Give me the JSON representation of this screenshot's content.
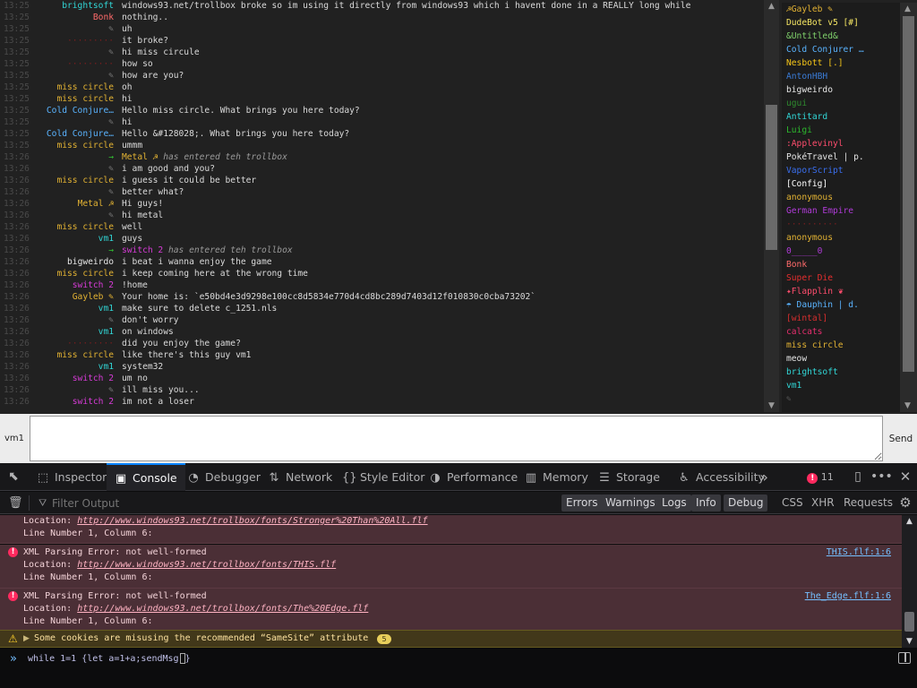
{
  "colors": {
    "timestamp": "#4a4a4a",
    "message_text": "#dadada",
    "devtools_bg": "#0c0c0d",
    "error_bg": "#4b2f36",
    "warning_bg": "#42381a",
    "accent": "#0a84ff"
  },
  "chat": {
    "messages": [
      {
        "time": "13:25",
        "nick": "brightsoft",
        "nick_color": "#31d6d6",
        "text": "windows93.net/trollbox broke so im using it directly from windows93 which i havent done in a REALLY long while",
        "type": "msg"
      },
      {
        "time": "13:25",
        "nick": "Bonk",
        "nick_color": "#ff6b6b",
        "text": "nothing..",
        "type": "msg"
      },
      {
        "time": "13:25",
        "nick": "✎",
        "nick_color": "#777777",
        "text": "uh",
        "type": "msg"
      },
      {
        "time": "13:25",
        "nick": "·········",
        "nick_color": "#7a1f1f",
        "text": "it broke?",
        "type": "msg"
      },
      {
        "time": "13:25",
        "nick": "✎",
        "nick_color": "#777777",
        "text": "hi miss circule",
        "type": "msg"
      },
      {
        "time": "13:25",
        "nick": "·········",
        "nick_color": "#7a1f1f",
        "text": "how so",
        "type": "msg"
      },
      {
        "time": "13:25",
        "nick": "✎",
        "nick_color": "#777777",
        "text": "how are you?",
        "type": "msg"
      },
      {
        "time": "13:25",
        "nick": "miss circle",
        "nick_color": "#e2b233",
        "text": "oh",
        "type": "msg"
      },
      {
        "time": "13:25",
        "nick": "miss circle",
        "nick_color": "#e2b233",
        "text": "hi",
        "type": "msg"
      },
      {
        "time": "13:25",
        "nick": "Cold Conjure…",
        "nick_color": "#5ab4ff",
        "text": "Hello miss circle. What brings you here today?",
        "type": "msg"
      },
      {
        "time": "13:25",
        "nick": "✎",
        "nick_color": "#777777",
        "text": "hi",
        "type": "msg"
      },
      {
        "time": "13:25",
        "nick": "Cold Conjure…",
        "nick_color": "#5ab4ff",
        "text": "Hello &#128028;. What brings you here today?",
        "type": "msg"
      },
      {
        "time": "13:25",
        "nick": "miss circle",
        "nick_color": "#e2b233",
        "text": "ummm",
        "type": "msg"
      },
      {
        "time": "13:26",
        "nick": "→",
        "nick_color": "#33c733",
        "sys_name": "Metal ☭",
        "sys_color": "#e2b233",
        "text": "has entered teh trollbox",
        "type": "sys"
      },
      {
        "time": "13:26",
        "nick": "✎",
        "nick_color": "#777777",
        "text": "i am good and you?",
        "type": "msg"
      },
      {
        "time": "13:26",
        "nick": "miss circle",
        "nick_color": "#e2b233",
        "text": "i guess it could be better",
        "type": "msg"
      },
      {
        "time": "13:26",
        "nick": "✎",
        "nick_color": "#777777",
        "text": "better what?",
        "type": "msg"
      },
      {
        "time": "13:26",
        "nick": "Metal ☭",
        "nick_color": "#e2b233",
        "text": "Hi guys!",
        "type": "msg"
      },
      {
        "time": "13:26",
        "nick": "✎",
        "nick_color": "#777777",
        "text": "hi metal",
        "type": "msg"
      },
      {
        "time": "13:26",
        "nick": "miss circle",
        "nick_color": "#e2b233",
        "text": "well",
        "type": "msg"
      },
      {
        "time": "13:26",
        "nick": "vm1",
        "nick_color": "#31d6d6",
        "text": "guys",
        "type": "msg"
      },
      {
        "time": "13:26",
        "nick": "→",
        "nick_color": "#33c733",
        "sys_name": "switch 2",
        "sys_color": "#d83bd8",
        "text": "has entered teh trollbox",
        "type": "sys"
      },
      {
        "time": "13:26",
        "nick": "bigweirdo",
        "nick_color": "#e6e6e6",
        "text": "i beat i wanna enjoy the game",
        "type": "msg"
      },
      {
        "time": "13:26",
        "nick": "miss circle",
        "nick_color": "#e2b233",
        "text": "i keep coming here at the wrong time",
        "type": "msg"
      },
      {
        "time": "13:26",
        "nick": "switch 2",
        "nick_color": "#d83bd8",
        "text": "!home",
        "type": "msg"
      },
      {
        "time": "13:26",
        "nick": "Gayleb ✎",
        "nick_color": "#e2b233",
        "text": "Your home is: `e50bd4e3d9298e100cc8d5834e770d4cd8bc289d7403d12f010830c0cba73202`",
        "type": "msg"
      },
      {
        "time": "13:26",
        "nick": "vm1",
        "nick_color": "#31d6d6",
        "text": "make sure to delete c_1251.nls",
        "type": "msg"
      },
      {
        "time": "13:26",
        "nick": "✎",
        "nick_color": "#777777",
        "text": "don't worry",
        "type": "msg"
      },
      {
        "time": "13:26",
        "nick": "vm1",
        "nick_color": "#31d6d6",
        "text": "on windows",
        "type": "msg"
      },
      {
        "time": "13:26",
        "nick": "·········",
        "nick_color": "#7a1f1f",
        "text": "did you enjoy the game?",
        "type": "msg"
      },
      {
        "time": "13:26",
        "nick": "miss circle",
        "nick_color": "#e2b233",
        "text": "like there's this guy vm1",
        "type": "msg"
      },
      {
        "time": "13:26",
        "nick": "vm1",
        "nick_color": "#31d6d6",
        "text": "system32",
        "type": "msg"
      },
      {
        "time": "13:26",
        "nick": "switch 2",
        "nick_color": "#d83bd8",
        "text": "um no",
        "type": "msg"
      },
      {
        "time": "13:26",
        "nick": "✎",
        "nick_color": "#777777",
        "text": "ill miss you...",
        "type": "msg"
      },
      {
        "time": "13:26",
        "nick": "switch 2",
        "nick_color": "#d83bd8",
        "text": "im not a loser",
        "type": "msg"
      }
    ]
  },
  "users": [
    {
      "name": "☭Gayleb ✎",
      "color": "#e2b233"
    },
    {
      "name": "DudeBot v5 [#]",
      "color": "#f5e663"
    },
    {
      "name": "&Untitled&",
      "color": "#7fd16b"
    },
    {
      "name": "Cold Conjurer …",
      "color": "#5ab4ff"
    },
    {
      "name": "Nesbott [.]",
      "color": "#f5c518"
    },
    {
      "name": "AntonHBH",
      "color": "#3a7bd5"
    },
    {
      "name": "bigweirdo",
      "color": "#e6e6e6"
    },
    {
      "name": "ugui",
      "color": "#2e8b2e"
    },
    {
      "name": "Antitard",
      "color": "#31d6d6"
    },
    {
      "name": "Luigi",
      "color": "#2db82d"
    },
    {
      "name": ":Applevinyl",
      "color": "#ff4d6d"
    },
    {
      "name": "PokéTravel | p.",
      "color": "#e6e6e6"
    },
    {
      "name": "VaporScript",
      "color": "#3a6ff0"
    },
    {
      "name": "[Config]",
      "color": "#ffffff"
    },
    {
      "name": "anonymous",
      "color": "#e2b233"
    },
    {
      "name": "German Empire",
      "color": "#b03bd8"
    },
    {
      "name": "··········",
      "color": "#7a1f1f"
    },
    {
      "name": "anonymous",
      "color": "#e2b233"
    },
    {
      "name": "0_____0",
      "color": "#b03bd8"
    },
    {
      "name": "Bonk",
      "color": "#ff6b6b"
    },
    {
      "name": "Super Die",
      "color": "#e62e2e"
    },
    {
      "name": "✦Flapplin ❦",
      "color": "#ff4d6d"
    },
    {
      "name": "☂ Dauphin | d.",
      "color": "#5ab4ff"
    },
    {
      "name": "[wintal]",
      "color": "#d62e2e"
    },
    {
      "name": "calcats",
      "color": "#e62e6e"
    },
    {
      "name": "miss circle",
      "color": "#e2b233"
    },
    {
      "name": "meow",
      "color": "#e6e6e6"
    },
    {
      "name": "brightsoft",
      "color": "#31d6d6"
    },
    {
      "name": "vm1",
      "color": "#31d6d6"
    },
    {
      "name": "✎",
      "color": "#555555"
    }
  ],
  "input": {
    "nick": "vm1",
    "value": "",
    "send_label": "Send"
  },
  "devtools": {
    "tabs": [
      {
        "label": "Inspector",
        "icon": "⬚"
      },
      {
        "label": "Console",
        "icon": "▣"
      },
      {
        "label": "Debugger",
        "icon": "◔"
      },
      {
        "label": "Network",
        "icon": "⇅"
      },
      {
        "label": "Style Editor",
        "icon": "{}"
      },
      {
        "label": "Performance",
        "icon": "◑"
      },
      {
        "label": "Memory",
        "icon": "▥"
      },
      {
        "label": "Storage",
        "icon": "☰"
      },
      {
        "label": "Accessibility",
        "icon": "♿"
      }
    ],
    "active_tab": "Console",
    "error_count": "11",
    "filter_placeholder": "Filter Output",
    "filter_buttons": [
      {
        "label": "Errors",
        "on": true
      },
      {
        "label": "Warnings",
        "on": true
      },
      {
        "label": "Logs",
        "on": true
      },
      {
        "label": "Info",
        "on": true
      },
      {
        "label": "Debug",
        "on": true
      },
      {
        "label": "CSS",
        "on": false
      },
      {
        "label": "XHR",
        "on": false
      },
      {
        "label": "Requests",
        "on": false
      }
    ],
    "partial_entry": {
      "location_label": "Location:",
      "location_url": "http://www.windows93.net/trollbox/fonts/Stronger%20Than%20All.flf",
      "line": "Line Number 1, Column 6:"
    },
    "entries": [
      {
        "title": "XML Parsing Error: not well-formed",
        "location_label": "Location:",
        "location_url": "http://www.windows93.net/trollbox/fonts/THIS.flf",
        "line": "Line Number 1, Column 6:",
        "source": "THIS.flf:1:6"
      },
      {
        "title": "XML Parsing Error: not well-formed",
        "location_label": "Location:",
        "location_url": "http://www.windows93.net/trollbox/fonts/The%20Edge.flf",
        "line": "Line Number 1, Column 6:",
        "source": "The_Edge.flf:1:6"
      }
    ],
    "warning": {
      "text": "Some cookies are misusing the recommended “SameSite” attribute",
      "count": "5"
    },
    "prompt": "while 1=1 {let a=1+a;sendMsg"
  }
}
